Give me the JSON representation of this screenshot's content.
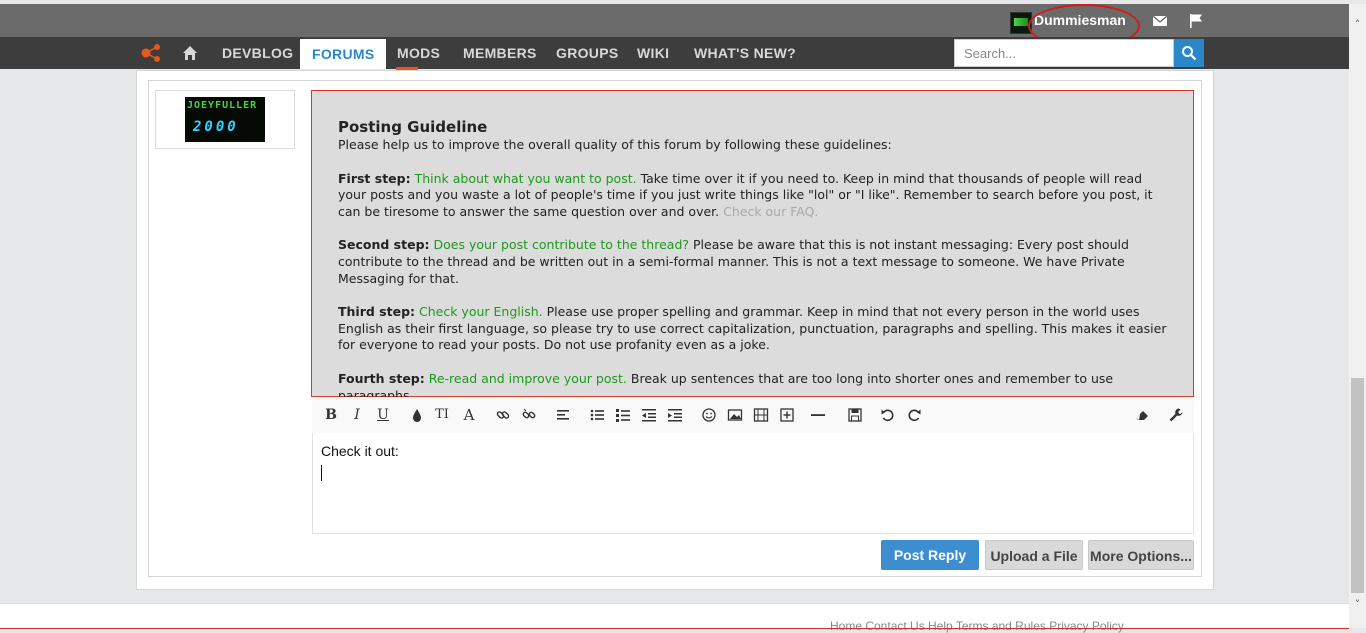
{
  "user": {
    "name": "Dummiesman"
  },
  "nav": {
    "items": [
      "DEVBLOG",
      "FORUMS",
      "MODS",
      "MEMBERS",
      "GROUPS",
      "WIKI",
      "WHAT'S NEW?"
    ],
    "active": "FORUMS"
  },
  "search": {
    "placeholder": "Search..."
  },
  "avatar": {
    "line1": "JOEYFULLER",
    "line2": "2000"
  },
  "guideline": {
    "title": "Posting Guideline",
    "intro": "Please help us to improve the overall quality of this forum by following these guidelines:",
    "steps": [
      {
        "label": "First step:",
        "highlight": "Think about what you want to post.",
        "text": "Take time over it if you need to. Keep in mind that thousands of people will read your posts and you waste a lot of people's time if you just write things like \"lol\" or \"I like\". Remember to search before you post, it can be tiresome to answer the same question over and over.",
        "link": "Check our FAQ."
      },
      {
        "label": "Second step:",
        "highlight": "Does your post contribute to the thread?",
        "text": "Please be aware that this is not instant messaging: Every post should contribute to the thread and be written out in a semi-formal manner. This is not a text message to someone. We have Private Messaging for that."
      },
      {
        "label": "Third step:",
        "highlight": "Check your English.",
        "text": "Please use proper spelling and grammar. Keep in mind that not every person in the world uses English as their first language, so please try to use correct capitalization, punctuation, paragraphs and spelling. This makes it easier for everyone to read your posts. Do not use profanity even as a joke."
      },
      {
        "label": "Fourth step:",
        "highlight": "Re-read and improve your post.",
        "text": "Break up sentences that are too long into shorter ones and remember to use paragraphs."
      }
    ]
  },
  "editor": {
    "content": "Check it out:"
  },
  "buttons": {
    "post_reply": "Post Reply",
    "upload": "Upload a File",
    "more": "More Options..."
  },
  "footer": {
    "links": "Home   Contact Us   Help   Terms and Rules   Privacy Policy"
  },
  "colors": {
    "accent": "#2a88c8",
    "highlight": "#1c9a1c",
    "border_red": "#d43c2a"
  }
}
